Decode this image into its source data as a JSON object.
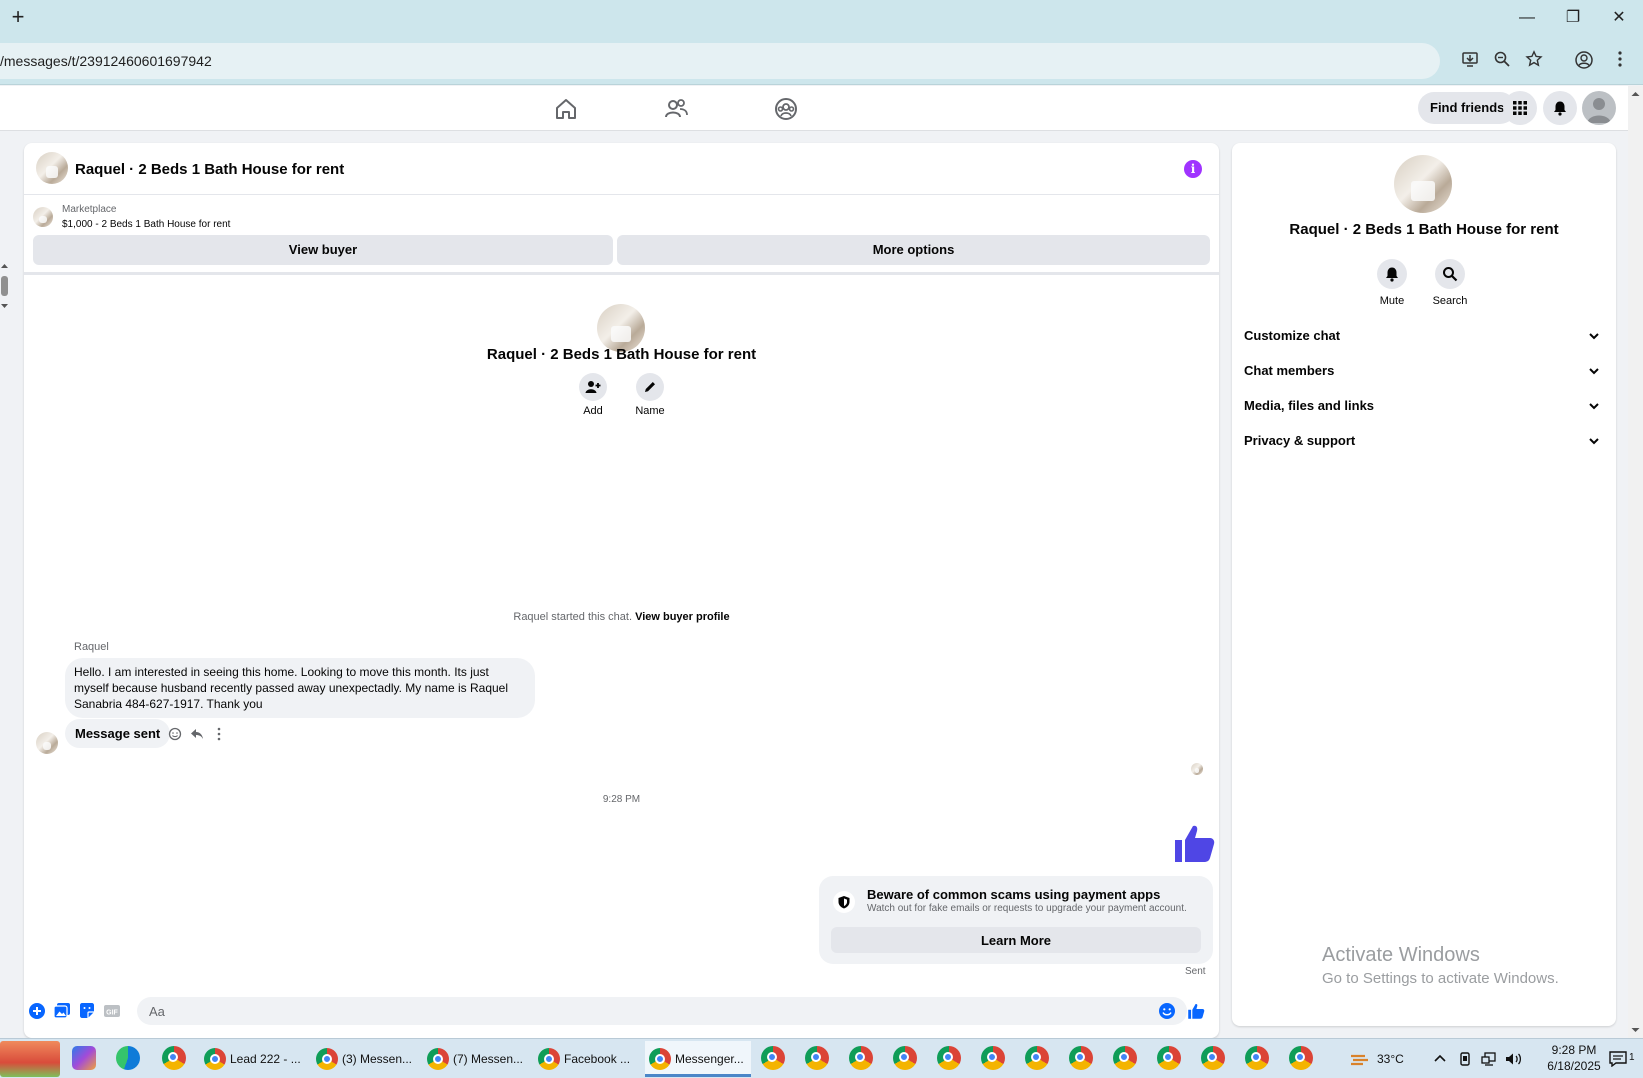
{
  "browser": {
    "url": "/messages/t/23912460601697942",
    "new_tab_label": "+",
    "window_controls": [
      "—",
      "❐",
      "✕"
    ]
  },
  "fbnav": {
    "find_friends_label": "Find friends"
  },
  "chat": {
    "title": "Raquel · 2 Beds 1 Bath House for rent",
    "marketplace_label": "Marketplace",
    "listing_summary": "$1,000 - 2 Beds 1 Bath House for rent",
    "view_buyer_label": "View buyer",
    "more_options_label": "More options",
    "center_title": "Raquel · 2 Beds 1 Bath House for rent",
    "add_label": "Add",
    "name_label": "Name",
    "started_text": "Raquel started this chat.",
    "view_buyer_profile_label": "View buyer profile",
    "sender_name": "Raquel",
    "incoming_message": "Hello. I am interested in seeing this home. Looking to move this month. Its just myself because husband recently passed away unexpectadly. My name is Raquel Sanabria 484-627-1917. Thank you",
    "message_sent_label": "Message sent",
    "timestamp": "9:28 PM",
    "scam_title": "Beware of common scams using payment apps",
    "scam_subtitle": "Watch out for fake emails or requests to upgrade your payment account.",
    "learn_more_label": "Learn More",
    "sent_status": "Sent",
    "composer_placeholder": "Aa",
    "accent_color": "#0866ff",
    "like_color": "#4f46e5"
  },
  "info_panel": {
    "title": "Raquel · 2 Beds 1 Bath House for rent",
    "mute_label": "Mute",
    "search_label": "Search",
    "sections": [
      {
        "label": "Customize chat"
      },
      {
        "label": "Chat members"
      },
      {
        "label": "Media, files and links"
      },
      {
        "label": "Privacy & support"
      }
    ]
  },
  "watermark": {
    "line1": "Activate Windows",
    "line2": "Go to Settings to activate Windows."
  },
  "taskbar": {
    "items": [
      {
        "label": "Lead 222 - ..."
      },
      {
        "label": "(3) Messen..."
      },
      {
        "label": "(7) Messen..."
      },
      {
        "label": "Facebook ..."
      },
      {
        "label": "Messenger..."
      }
    ],
    "weather": "33°C",
    "time": "9:28 PM",
    "date": "6/18/2025",
    "notification_count": "1"
  }
}
